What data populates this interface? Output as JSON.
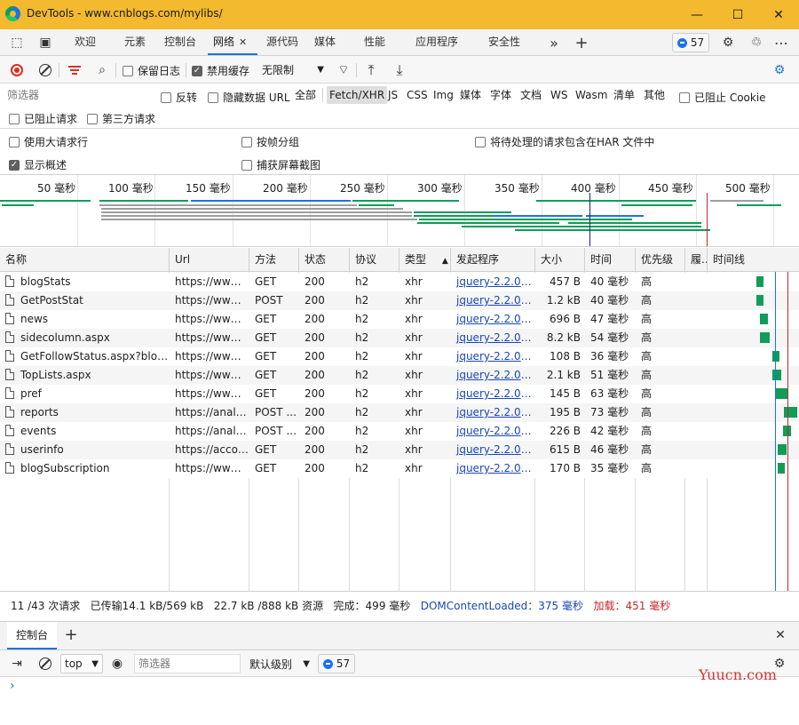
{
  "window": {
    "title": "DevTools - www.cnblogs.com/mylibs/",
    "minimize_icon": "minimize-icon",
    "maximize_icon": "maximize-icon",
    "close_icon": "close-icon"
  },
  "main_tabs": [
    {
      "label": "欢迎",
      "active": false
    },
    {
      "label": "元素",
      "active": false
    },
    {
      "label": "控制台",
      "active": false
    },
    {
      "label": "网络",
      "active": true
    },
    {
      "label": "源代码",
      "active": false
    },
    {
      "label": "媒体",
      "active": false
    },
    {
      "label": "性能",
      "active": false
    },
    {
      "label": "应用程序",
      "active": false
    },
    {
      "label": "安全性",
      "active": false
    }
  ],
  "issues_count": "57",
  "network_toolbar": {
    "preserve_log": {
      "label": "保留日志",
      "checked": false
    },
    "disable_cache": {
      "label": "禁用缓存",
      "checked": true
    },
    "throttling": "无限制"
  },
  "filter": {
    "placeholder": "筛选器",
    "invert": {
      "label": "反转",
      "checked": false
    },
    "hide_data_urls": {
      "label": "隐藏数据 URL",
      "checked": false
    },
    "types": [
      {
        "label": "全部",
        "selected": false
      },
      {
        "label": "Fetch/XHR",
        "selected": true
      },
      {
        "label": "JS",
        "selected": false
      },
      {
        "label": "CSS",
        "selected": false
      },
      {
        "label": "Img",
        "selected": false
      },
      {
        "label": "媒体",
        "selected": false
      },
      {
        "label": "字体",
        "selected": false
      },
      {
        "label": "文档",
        "selected": false
      },
      {
        "label": "WS",
        "selected": false
      },
      {
        "label": "Wasm",
        "selected": false
      },
      {
        "label": "清单",
        "selected": false
      },
      {
        "label": "其他",
        "selected": false
      }
    ],
    "blocked_cookies": {
      "label": "已阻止 Cookie",
      "checked": false
    },
    "blocked_requests": {
      "label": "已阻止请求",
      "checked": false
    },
    "third_party": {
      "label": "第三方请求",
      "checked": false
    }
  },
  "settings": {
    "large_rows": {
      "label": "使用大请求行",
      "checked": false
    },
    "group_by_frame": {
      "label": "按帧分组",
      "checked": false
    },
    "har_pending": {
      "label": "将待处理的请求包含在HAR 文件中",
      "checked": false
    },
    "show_overview": {
      "label": "显示概述",
      "checked": true
    },
    "capture_screenshots": {
      "label": "捕获屏幕截图",
      "checked": false
    }
  },
  "overview": {
    "ticks": [
      "50 毫秒",
      "100 毫秒",
      "150 毫秒",
      "200 毫秒",
      "250 毫秒",
      "300 毫秒",
      "350 毫秒",
      "400 毫秒",
      "450 毫秒",
      "500 毫秒"
    ],
    "colors": {
      "green": "#0f9d58",
      "gray": "#9e9e9e",
      "blue": "#1a73e8",
      "dcl": "#1a237e",
      "load": "#c62828"
    }
  },
  "table": {
    "headers": {
      "name": "名称",
      "url": "Url",
      "method": "方法",
      "status": "状态",
      "protocol": "协议",
      "type": "类型",
      "initiator": "发起程序",
      "size": "大小",
      "time": "时间",
      "priority": "优先级",
      "fulfilled": "履...",
      "waterfall": "时间线"
    },
    "rows": [
      {
        "name": "blogStats",
        "url": "https://www....",
        "method": "GET",
        "status": "200",
        "protocol": "h2",
        "type": "xhr",
        "initiator": "jquery-2.2.0.m...",
        "size": "457 B",
        "time": "40 毫秒",
        "priority": "高"
      },
      {
        "name": "GetPostStat",
        "url": "https://www....",
        "method": "POST",
        "status": "200",
        "protocol": "h2",
        "type": "xhr",
        "initiator": "jquery-2.2.0.m...",
        "size": "1.2 kB",
        "time": "40 毫秒",
        "priority": "高"
      },
      {
        "name": "news",
        "url": "https://www....",
        "method": "GET",
        "status": "200",
        "protocol": "h2",
        "type": "xhr",
        "initiator": "jquery-2.2.0.m...",
        "size": "696 B",
        "time": "47 毫秒",
        "priority": "高"
      },
      {
        "name": "sidecolumn.aspx",
        "url": "https://www....",
        "method": "GET",
        "status": "200",
        "protocol": "h2",
        "type": "xhr",
        "initiator": "jquery-2.2.0.m...",
        "size": "8.2 kB",
        "time": "54 毫秒",
        "priority": "高"
      },
      {
        "name": "GetFollowStatus.aspx?blogU...",
        "url": "https://www....",
        "method": "GET",
        "status": "200",
        "protocol": "h2",
        "type": "xhr",
        "initiator": "jquery-2.2.0.m...",
        "size": "108 B",
        "time": "36 毫秒",
        "priority": "高"
      },
      {
        "name": "TopLists.aspx",
        "url": "https://www....",
        "method": "GET",
        "status": "200",
        "protocol": "h2",
        "type": "xhr",
        "initiator": "jquery-2.2.0.m...",
        "size": "2.1 kB",
        "time": "51 毫秒",
        "priority": "高"
      },
      {
        "name": "pref",
        "url": "https://www....",
        "method": "GET",
        "status": "200",
        "protocol": "h2",
        "type": "xhr",
        "initiator": "jquery-2.2.0.m...",
        "size": "145 B",
        "time": "63 毫秒",
        "priority": "高"
      },
      {
        "name": "reports",
        "url": "https://analyt...",
        "method": "POST ...",
        "status": "200",
        "protocol": "h2",
        "type": "xhr",
        "initiator": "jquery-2.2.0.m...",
        "size": "195 B",
        "time": "73 毫秒",
        "priority": "高"
      },
      {
        "name": "events",
        "url": "https://analyt...",
        "method": "POST ...",
        "status": "200",
        "protocol": "h2",
        "type": "xhr",
        "initiator": "jquery-2.2.0.m...",
        "size": "226 B",
        "time": "42 毫秒",
        "priority": "高"
      },
      {
        "name": "userinfo",
        "url": "https://accou...",
        "method": "GET",
        "status": "200",
        "protocol": "h2",
        "type": "xhr",
        "initiator": "jquery-2.2.0.m...",
        "size": "615 B",
        "time": "46 毫秒",
        "priority": "高"
      },
      {
        "name": "blogSubscription",
        "url": "https://www....",
        "method": "GET",
        "status": "200",
        "protocol": "h2",
        "type": "xhr",
        "initiator": "jquery-2.2.0.m...",
        "size": "170 B",
        "time": "35 毫秒",
        "priority": "高"
      }
    ]
  },
  "summary": {
    "requests": "11 /43 次请求",
    "transferred": "已传输14.1 kB/569 kB",
    "resources": "22.7 kB /888 kB 资源",
    "finish": "完成：499 毫秒",
    "dcl": "DOMContentLoaded：375 毫秒",
    "load": "加载：451 毫秒"
  },
  "drawer": {
    "tab": "控制台",
    "context": "top",
    "filter_placeholder": "筛选器",
    "level": "默认级别",
    "issues_count": "57",
    "prompt": "›"
  },
  "watermark": "Yuucn.com"
}
